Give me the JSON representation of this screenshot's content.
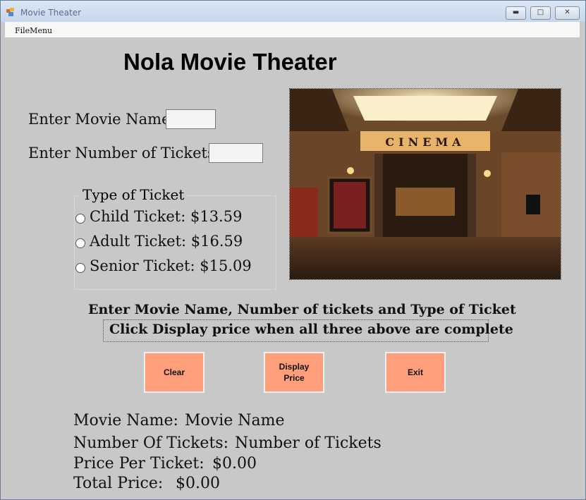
{
  "window": {
    "title": "Movie Theater"
  },
  "menu": {
    "file": "FileMenu"
  },
  "heading": "Nola Movie Theater",
  "form": {
    "movie_name_label": "Enter Movie Name",
    "tickets_label": "Enter Number of Tickets:",
    "movie_name_value": "",
    "tickets_value": ""
  },
  "ticket_group": {
    "title": "Type of Ticket",
    "options": [
      {
        "label": "Child Ticket: $13.59"
      },
      {
        "label": "Adult Ticket: $16.59"
      },
      {
        "label": "Senior Ticket: $15.09"
      }
    ]
  },
  "image": {
    "sign_text": "CINEMA"
  },
  "instructions": {
    "line1": "Enter Movie Name, Number of tickets and Type of Ticket",
    "line2": "Click Display price when all three above are complete"
  },
  "buttons": {
    "clear": "Clear",
    "display": "Display\nPrice",
    "exit": "Exit"
  },
  "output": {
    "movie_name_label": "Movie Name:",
    "movie_name_value": "Movie Name",
    "tickets_label": "Number Of Tickets:",
    "tickets_value": "Number of Tickets",
    "price_label": "Price Per Ticket:",
    "price_value": "$0.00",
    "total_label": "Total Price:",
    "total_value": "$0.00"
  }
}
